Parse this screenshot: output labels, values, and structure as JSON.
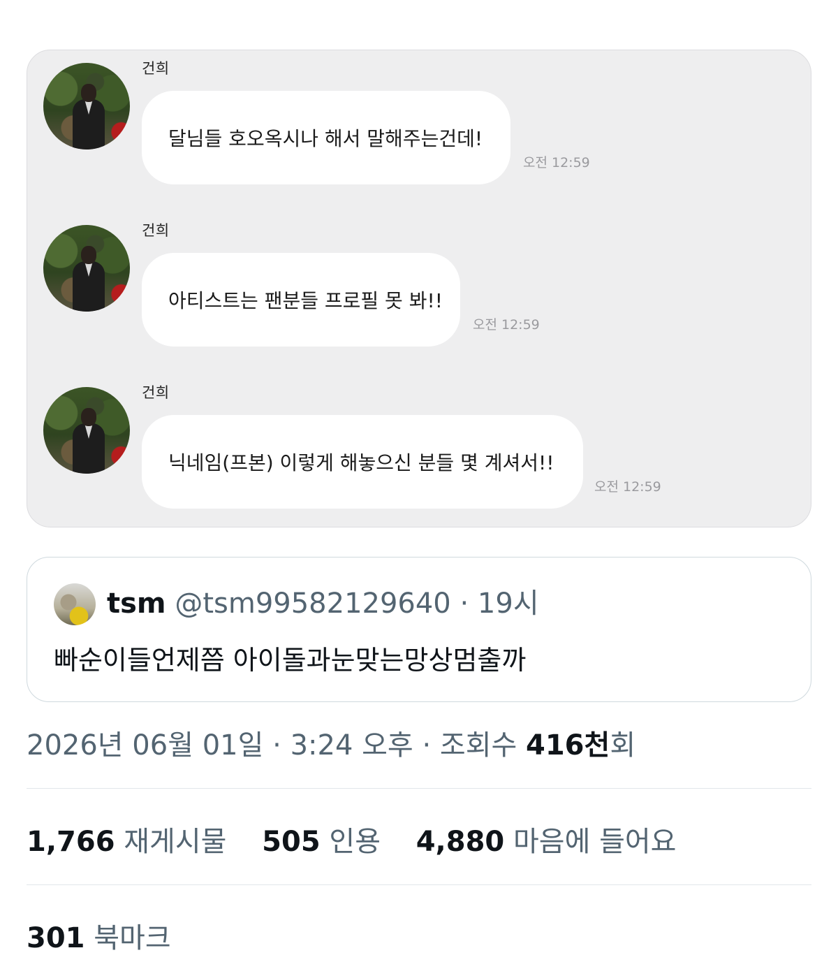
{
  "chat": {
    "messages": [
      {
        "sender": "건희",
        "text": "달님들 호오옥시나 해서 말해주는건데!",
        "time": "오전 12:59"
      },
      {
        "sender": "건희",
        "text": "아티스트는 팬분들 프로필 못 봐!!",
        "time": "오전 12:59"
      },
      {
        "sender": "건희",
        "text": "닉네임(프본) 이렇게 해놓으신 분들 몇 계셔서!!",
        "time": "오전 12:59"
      }
    ]
  },
  "quote": {
    "name": "tsm",
    "handle": "@tsm99582129640",
    "separator": "·",
    "time": "19시",
    "text": "빠순이들언제쯤 아이돌과눈맞는망상멈출까"
  },
  "meta": {
    "date": "2026년 06월 01일",
    "sep": "·",
    "time": "3:24 오후",
    "views_label": "조회수",
    "views_value": "416천",
    "views_suffix": "회"
  },
  "stats": {
    "reposts_count": "1,766",
    "reposts_label": "재게시물",
    "quotes_count": "505",
    "quotes_label": "인용",
    "likes_count": "4,880",
    "likes_label": "마음에 들어요",
    "bookmarks_count": "301",
    "bookmarks_label": "북마크"
  }
}
